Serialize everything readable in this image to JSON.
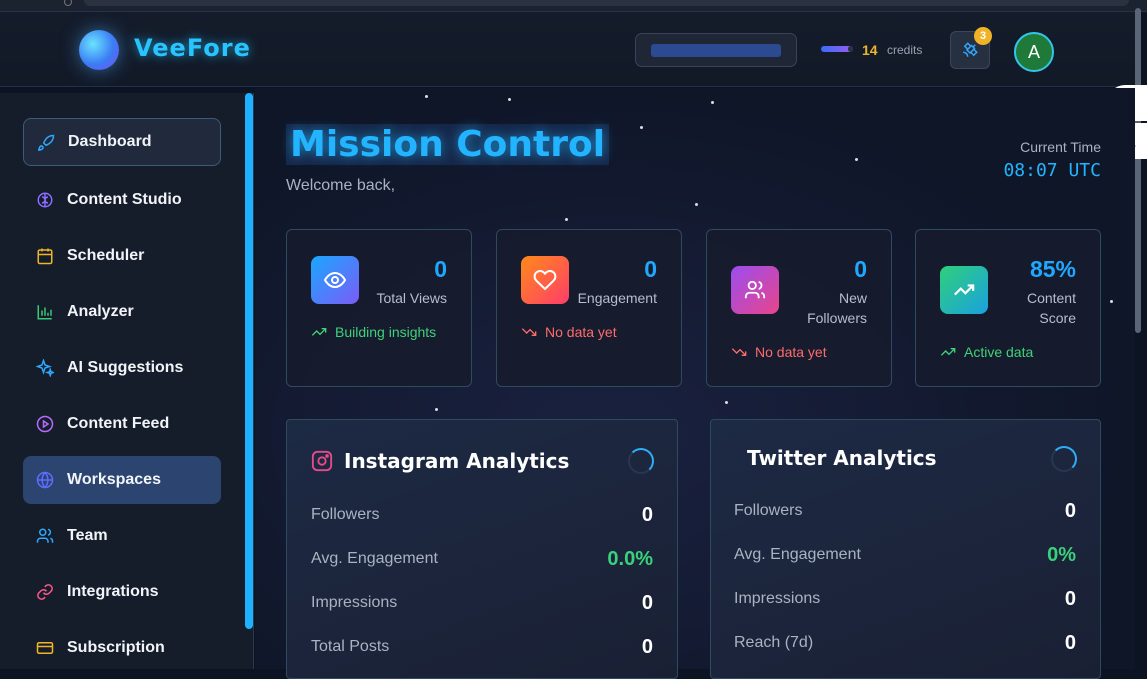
{
  "app": {
    "name": "VeeFore"
  },
  "header": {
    "credits_count": "14",
    "credits_label": "credits",
    "notification_count": "3",
    "avatar_initial": "A"
  },
  "sidebar": {
    "items": [
      {
        "label": "Dashboard",
        "icon": "rocket-icon",
        "color": "#2ea7ff"
      },
      {
        "label": "Content Studio",
        "icon": "brain-icon",
        "color": "#8a6cff"
      },
      {
        "label": "Scheduler",
        "icon": "calendar-icon",
        "color": "#f2b527"
      },
      {
        "label": "Analyzer",
        "icon": "bar-chart-icon",
        "color": "#37c978"
      },
      {
        "label": "AI Suggestions",
        "icon": "sparkles-icon",
        "color": "#2ea7ff"
      },
      {
        "label": "Content Feed",
        "icon": "play-circle-icon",
        "color": "#b46cff"
      },
      {
        "label": "Workspaces",
        "icon": "globe-icon",
        "color": "#5c6cff"
      },
      {
        "label": "Team",
        "icon": "users-icon",
        "color": "#2ea7ff"
      },
      {
        "label": "Integrations",
        "icon": "link-icon",
        "color": "#ff5a8a"
      },
      {
        "label": "Subscription",
        "icon": "credit-card-icon",
        "color": "#f2b527"
      }
    ]
  },
  "main": {
    "title": "Mission Control",
    "welcome": "Welcome back,",
    "time_label": "Current Time",
    "time_value": "08:07 UTC"
  },
  "stats": [
    {
      "value": "0",
      "label": "Total Views",
      "trend": "Building insights",
      "trend_color": "#3fd27a"
    },
    {
      "value": "0",
      "label": "Engagement",
      "trend": "No data yet",
      "trend_color": "#ff6b6b"
    },
    {
      "value": "0",
      "label": "New Followers",
      "trend": "No data yet",
      "trend_color": "#ff6b6b"
    },
    {
      "value": "85%",
      "label": "Content Score",
      "trend": "Active data",
      "trend_color": "#3fd27a"
    }
  ],
  "instagram": {
    "title": "Instagram Analytics",
    "rows": [
      {
        "label": "Followers",
        "value": "0"
      },
      {
        "label": "Avg. Engagement",
        "value": "0.0%"
      },
      {
        "label": "Impressions",
        "value": "0"
      },
      {
        "label": "Total Posts",
        "value": "0"
      }
    ]
  },
  "twitter": {
    "title": "Twitter Analytics",
    "rows": [
      {
        "label": "Followers",
        "value": "0"
      },
      {
        "label": "Avg. Engagement",
        "value": "0%"
      },
      {
        "label": "Impressions",
        "value": "0"
      },
      {
        "label": "Reach (7d)",
        "value": "0"
      }
    ]
  }
}
